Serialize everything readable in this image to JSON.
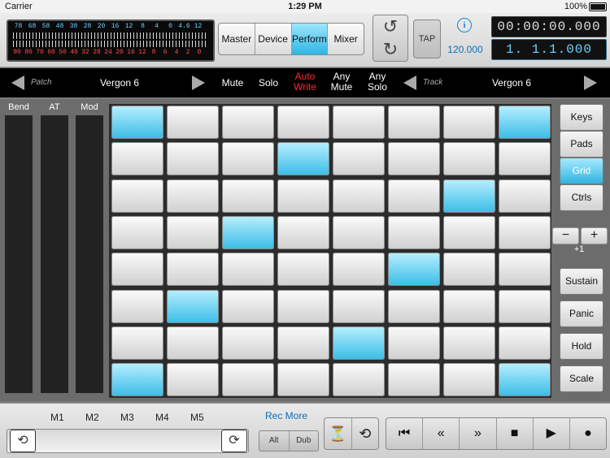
{
  "status": {
    "carrier": "Carrier",
    "time": "1:29 PM",
    "battery": "100%"
  },
  "meter": {
    "top": [
      "78",
      "68",
      "58",
      "48",
      "38",
      "28",
      "20",
      "16",
      "12",
      "8",
      "4",
      "0",
      "4.6",
      "12"
    ],
    "bottom": [
      "90",
      "80",
      "70",
      "60",
      "50",
      "40",
      "32",
      "28",
      "24",
      "20",
      "16",
      "12",
      "8",
      "6",
      "4",
      "2",
      "0"
    ]
  },
  "views": [
    "Master",
    "Device",
    "Perform",
    "Mixer"
  ],
  "active_view": "Perform",
  "undo_icon": "undo-icon",
  "redo_icon": "redo-icon",
  "tap": "TAP",
  "info": "i",
  "tempo": "120.000",
  "time_display": "00:00:00.000",
  "position_display": "1. 1.1.000",
  "nav": {
    "patch_label": "Patch",
    "patch_name": "Vergon 6",
    "mute": "Mute",
    "solo": "Solo",
    "auto_write_1": "Auto",
    "auto_write_2": "Write",
    "any_mute_1": "Any",
    "any_mute_2": "Mute",
    "any_solo_1": "Any",
    "any_solo_2": "Solo",
    "track_label": "Track",
    "track_name": "Vergon 6",
    "accent": "#ff2a2a"
  },
  "strips": [
    "Bend",
    "AT",
    "Mod"
  ],
  "grid": {
    "rows": 8,
    "cols": 8,
    "lit": [
      [
        0,
        0
      ],
      [
        0,
        7
      ],
      [
        1,
        3
      ],
      [
        2,
        6
      ],
      [
        3,
        2
      ],
      [
        4,
        5
      ],
      [
        5,
        1
      ],
      [
        6,
        4
      ],
      [
        7,
        0
      ],
      [
        7,
        7
      ]
    ],
    "lit_color": "#39bde6"
  },
  "side_tabs": [
    "Keys",
    "Pads",
    "Grid",
    "Ctrls"
  ],
  "active_side_tab": "Grid",
  "octave": {
    "minus": "−",
    "plus": "+",
    "value": "+1"
  },
  "side_buttons": [
    "Sustain",
    "Panic",
    "Hold",
    "Scale"
  ],
  "macros": [
    "M1",
    "M2",
    "M3",
    "M4",
    "M5"
  ],
  "rec_more": "Rec More",
  "alt": "Alt",
  "dub": "Dub",
  "transport": [
    "⏮",
    "«",
    "»",
    "■",
    "▶",
    "●"
  ]
}
